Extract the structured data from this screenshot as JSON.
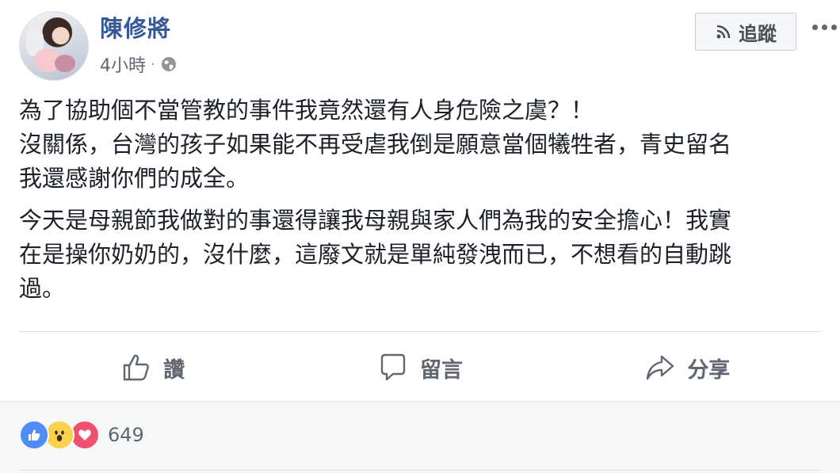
{
  "post": {
    "author_name": "陳修將",
    "time_ago": "4小時",
    "separator": "·",
    "privacy_icon": "globe-icon",
    "follow_label": "追蹤",
    "follow_icon": "rss-icon",
    "more_icon": "more-icon",
    "text_lines": [
      "為了協助個不當管教的事件我竟然還有人身危險之虞？！",
      "沒關係，台灣的孩子如果能不再受虐我倒是願意當個犧牲者，青史留名",
      "我還感謝你們的成全。"
    ],
    "text_lines_2": [
      "今天是母親節我做對的事還得讓我母親與家人們為我的安全擔心！我實",
      "在是操你奶奶的，沒什麼，這廢文就是單純發洩而已，不想看的自動跳",
      "過。"
    ]
  },
  "actions": {
    "like_label": "讚",
    "comment_label": "留言",
    "share_label": "分享"
  },
  "reactions": {
    "types": [
      "like",
      "wow",
      "love"
    ],
    "count": "649"
  },
  "colors": {
    "author": "#365899",
    "meta": "#606770",
    "text": "#1d2129",
    "like_blue": "#4f8cf7",
    "love_red": "#f0506e",
    "wow_yellow": "#fcd24d"
  }
}
